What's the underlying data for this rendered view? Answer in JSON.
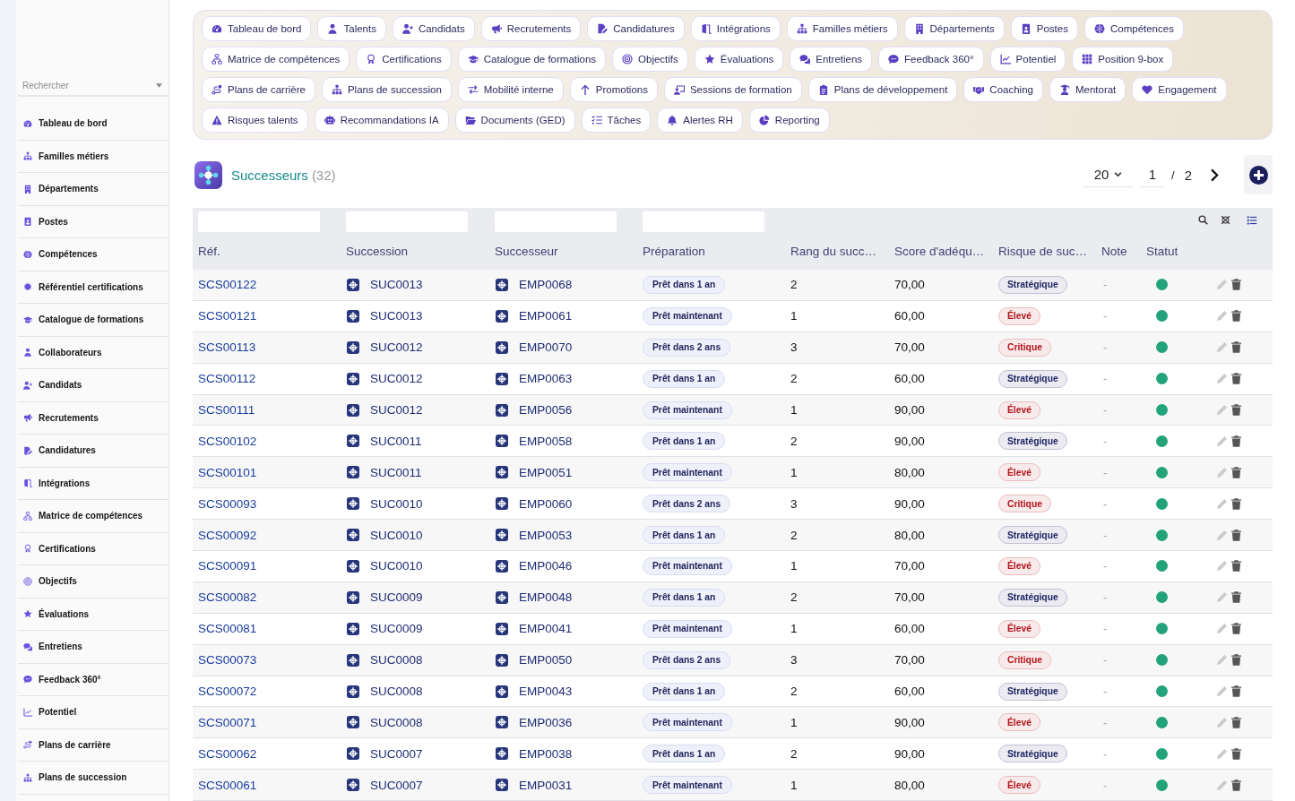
{
  "sidebar": {
    "search": {
      "placeholder": "Rechercher"
    },
    "items": [
      "Tableau de bord",
      "Familles métiers",
      "Départements",
      "Postes",
      "Compétences",
      "Référentiel certifications",
      "Catalogue de formations",
      "Collaborateurs",
      "Candidats",
      "Recrutements",
      "Candidatures",
      "Intégrations",
      "Matrice de compétences",
      "Certifications",
      "Objectifs",
      "Évaluations",
      "Entretiens",
      "Feedback 360°",
      "Potentiel",
      "Plans de carrière",
      "Plans de succession"
    ]
  },
  "nav": {
    "tabs": [
      "Tableau de bord",
      "Talents",
      "Candidats",
      "Recrutements",
      "Candidatures",
      "Intégrations",
      "Familles métiers",
      "Départements",
      "Postes",
      "Compétences",
      "Matrice de compétences",
      "Certifications",
      "Catalogue de formations",
      "Objectifs",
      "Évaluations",
      "Entretiens",
      "Feedback 360°",
      "Potentiel",
      "Position 9-box",
      "Plans de carrière",
      "Plans de succession",
      "Mobilité interne",
      "Promotions",
      "Sessions de formation",
      "Plans de développement",
      "Coaching",
      "Mentorat",
      "Engagement",
      "Risques talents",
      "Recommandations IA",
      "Documents (GED)",
      "Tâches",
      "Alertes RH",
      "Reporting"
    ]
  },
  "header": {
    "title": "Successeurs",
    "count": "(32)",
    "pagination": {
      "page_size": "20",
      "page": "1",
      "separator": "/",
      "page_count": "2"
    }
  },
  "table": {
    "columns": [
      {
        "label": "Réf.",
        "filter": true
      },
      {
        "label": "Succession",
        "filter": true
      },
      {
        "label": "Successeur",
        "filter": true
      },
      {
        "label": "Préparation",
        "filter": true
      },
      {
        "label": "Rang du succ…",
        "filter": false
      },
      {
        "label": "Score d'adéqu…",
        "filter": false
      },
      {
        "label": "Risque de suc…",
        "filter": false
      },
      {
        "label": "Note",
        "filter": false
      },
      {
        "label": "Statut",
        "filter": false
      }
    ],
    "rows": [
      {
        "ref": "SCS00122",
        "succession": "SUC0013",
        "successor": "EMP0068",
        "preparation": "Prêt dans 1 an",
        "rank": "2",
        "score": "70,00",
        "risk": {
          "label": "Stratégique",
          "color": "#1f2563"
        },
        "note": "-",
        "status": {
          "color": "#22a37a"
        }
      },
      {
        "ref": "SCS00121",
        "succession": "SUC0013",
        "successor": "EMP0061",
        "preparation": "Prêt maintenant",
        "rank": "1",
        "score": "60,00",
        "risk": {
          "label": "Élevé",
          "color": "#b3141b"
        },
        "note": "-",
        "status": {
          "color": "#22a37a"
        }
      },
      {
        "ref": "SCS00113",
        "succession": "SUC0012",
        "successor": "EMP0070",
        "preparation": "Prêt dans 2 ans",
        "rank": "3",
        "score": "70,00",
        "risk": {
          "label": "Critique",
          "color": "#b3141b"
        },
        "note": "-",
        "status": {
          "color": "#22a37a"
        }
      },
      {
        "ref": "SCS00112",
        "succession": "SUC0012",
        "successor": "EMP0063",
        "preparation": "Prêt dans 1 an",
        "rank": "2",
        "score": "60,00",
        "risk": {
          "label": "Stratégique",
          "color": "#1f2563"
        },
        "note": "-",
        "status": {
          "color": "#22a37a"
        }
      },
      {
        "ref": "SCS00111",
        "succession": "SUC0012",
        "successor": "EMP0056",
        "preparation": "Prêt maintenant",
        "rank": "1",
        "score": "90,00",
        "risk": {
          "label": "Élevé",
          "color": "#b3141b"
        },
        "note": "-",
        "status": {
          "color": "#22a37a"
        }
      },
      {
        "ref": "SCS00102",
        "succession": "SUC0011",
        "successor": "EMP0058",
        "preparation": "Prêt dans 1 an",
        "rank": "2",
        "score": "90,00",
        "risk": {
          "label": "Stratégique",
          "color": "#1f2563"
        },
        "note": "-",
        "status": {
          "color": "#22a37a"
        }
      },
      {
        "ref": "SCS00101",
        "succession": "SUC0011",
        "successor": "EMP0051",
        "preparation": "Prêt maintenant",
        "rank": "1",
        "score": "80,00",
        "risk": {
          "label": "Élevé",
          "color": "#b3141b"
        },
        "note": "-",
        "status": {
          "color": "#22a37a"
        }
      },
      {
        "ref": "SCS00093",
        "succession": "SUC0010",
        "successor": "EMP0060",
        "preparation": "Prêt dans 2 ans",
        "rank": "3",
        "score": "90,00",
        "risk": {
          "label": "Critique",
          "color": "#b3141b"
        },
        "note": "-",
        "status": {
          "color": "#22a37a"
        }
      },
      {
        "ref": "SCS00092",
        "succession": "SUC0010",
        "successor": "EMP0053",
        "preparation": "Prêt dans 1 an",
        "rank": "2",
        "score": "80,00",
        "risk": {
          "label": "Stratégique",
          "color": "#1f2563"
        },
        "note": "-",
        "status": {
          "color": "#22a37a"
        }
      },
      {
        "ref": "SCS00091",
        "succession": "SUC0010",
        "successor": "EMP0046",
        "preparation": "Prêt maintenant",
        "rank": "1",
        "score": "70,00",
        "risk": {
          "label": "Élevé",
          "color": "#b3141b"
        },
        "note": "-",
        "status": {
          "color": "#22a37a"
        }
      },
      {
        "ref": "SCS00082",
        "succession": "SUC0009",
        "successor": "EMP0048",
        "preparation": "Prêt dans 1 an",
        "rank": "2",
        "score": "70,00",
        "risk": {
          "label": "Stratégique",
          "color": "#1f2563"
        },
        "note": "-",
        "status": {
          "color": "#22a37a"
        }
      },
      {
        "ref": "SCS00081",
        "succession": "SUC0009",
        "successor": "EMP0041",
        "preparation": "Prêt maintenant",
        "rank": "1",
        "score": "60,00",
        "risk": {
          "label": "Élevé",
          "color": "#b3141b"
        },
        "note": "-",
        "status": {
          "color": "#22a37a"
        }
      },
      {
        "ref": "SCS00073",
        "succession": "SUC0008",
        "successor": "EMP0050",
        "preparation": "Prêt dans 2 ans",
        "rank": "3",
        "score": "70,00",
        "risk": {
          "label": "Critique",
          "color": "#b3141b"
        },
        "note": "-",
        "status": {
          "color": "#22a37a"
        }
      },
      {
        "ref": "SCS00072",
        "succession": "SUC0008",
        "successor": "EMP0043",
        "preparation": "Prêt dans 1 an",
        "rank": "2",
        "score": "60,00",
        "risk": {
          "label": "Stratégique",
          "color": "#1f2563"
        },
        "note": "-",
        "status": {
          "color": "#22a37a"
        }
      },
      {
        "ref": "SCS00071",
        "succession": "SUC0008",
        "successor": "EMP0036",
        "preparation": "Prêt maintenant",
        "rank": "1",
        "score": "90,00",
        "risk": {
          "label": "Élevé",
          "color": "#b3141b"
        },
        "note": "-",
        "status": {
          "color": "#22a37a"
        }
      },
      {
        "ref": "SCS00062",
        "succession": "SUC0007",
        "successor": "EMP0038",
        "preparation": "Prêt dans 1 an",
        "rank": "2",
        "score": "90,00",
        "risk": {
          "label": "Stratégique",
          "color": "#1f2563"
        },
        "note": "-",
        "status": {
          "color": "#22a37a"
        }
      },
      {
        "ref": "SCS00061",
        "succession": "SUC0007",
        "successor": "EMP0031",
        "preparation": "Prêt maintenant",
        "rank": "1",
        "score": "80,00",
        "risk": {
          "label": "Élevé",
          "color": "#b3141b"
        },
        "note": "-",
        "status": {
          "color": "#22a37a"
        }
      }
    ]
  }
}
